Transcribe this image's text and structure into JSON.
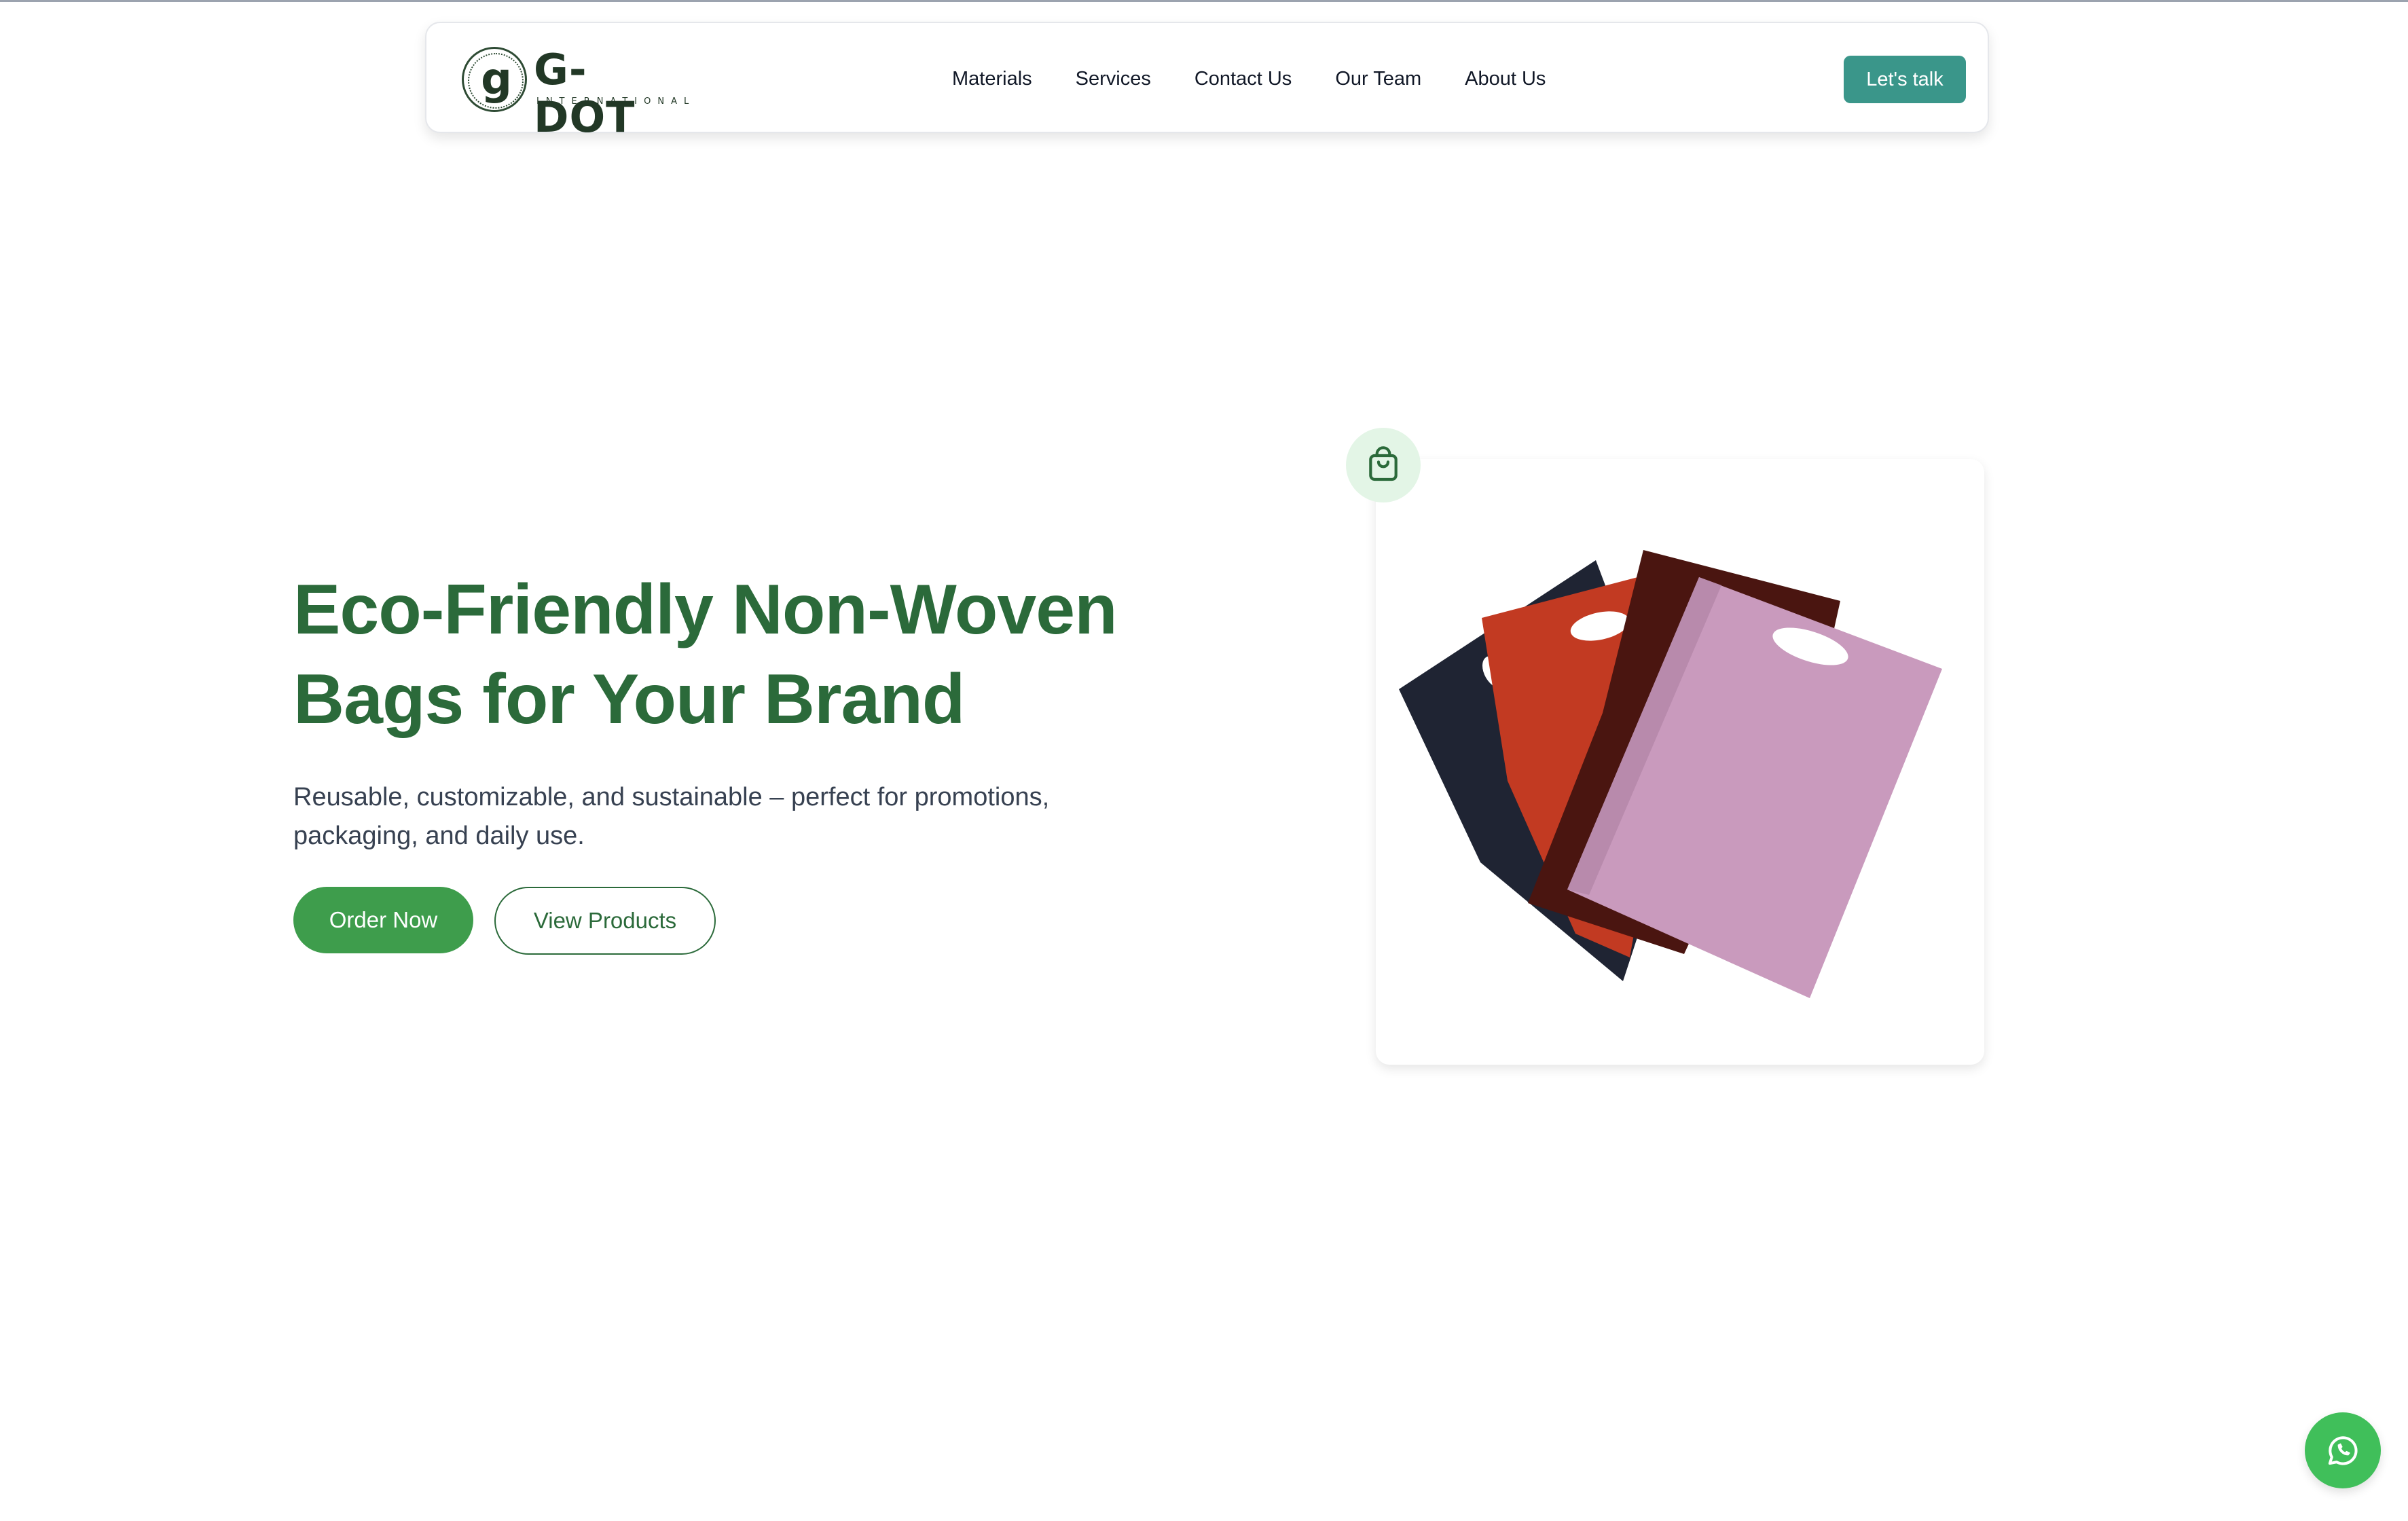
{
  "brand": {
    "mark": "g",
    "name": "G-DOT",
    "tagline": "INTERNATIONAL"
  },
  "nav": {
    "items": [
      {
        "label": "Materials"
      },
      {
        "label": "Services"
      },
      {
        "label": "Contact Us"
      },
      {
        "label": "Our Team"
      },
      {
        "label": "About Us"
      }
    ],
    "cta_label": "Let's talk"
  },
  "hero": {
    "title_line1": "Eco-Friendly Non-Woven",
    "title_line2": "Bags for Your Brand",
    "subtitle_line1": "Reusable, customizable, and sustainable – perfect for promotions,",
    "subtitle_line2": "packaging, and daily use.",
    "primary_button": "Order Now",
    "secondary_button": "View Products"
  },
  "product_card": {
    "badge_icon": "shopping-bag-icon",
    "bag_colors": [
      "#1f2433",
      "#c23a22",
      "#4a1510",
      "#c99abd"
    ]
  },
  "floating": {
    "icon": "whatsapp-icon",
    "color": "#40bf5a"
  },
  "colors": {
    "accent_green": "#2b6a3a",
    "button_green": "#3e9d4c",
    "cta_teal": "#3a968a"
  }
}
